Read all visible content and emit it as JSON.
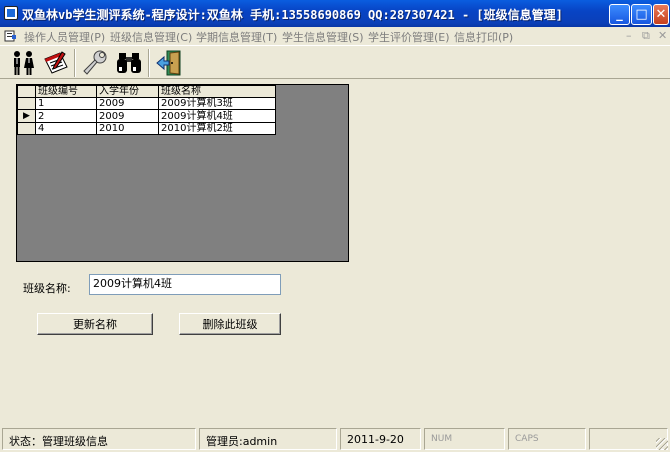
{
  "window": {
    "title": "双鱼林vb学生测评系统-程序设计:双鱼林 手机:13558690869 QQ:287307421 - [班级信息管理]",
    "minimize_glyph": "_",
    "maximize_glyph": "□",
    "close_glyph": "✕"
  },
  "menu": {
    "items": [
      {
        "label": "操作人员管理(P)"
      },
      {
        "label": "班级信息管理(C)"
      },
      {
        "label": "学期信息管理(T)"
      },
      {
        "label": "学生信息管理(S)"
      },
      {
        "label": "学生评价管理(E)"
      },
      {
        "label": "信息打印(P)"
      }
    ],
    "mdi_minimize": "–",
    "mdi_restore": "⧉",
    "mdi_close": "✕"
  },
  "toolbar": {
    "icons": [
      "users-icon",
      "edit-document-icon",
      "wrench-icon",
      "binoculars-icon",
      "exit-door-icon"
    ]
  },
  "grid": {
    "columns": [
      "班级编号",
      "入学年份",
      "班级名称"
    ],
    "rows": [
      {
        "selected": false,
        "cells": [
          "1",
          "2009",
          "2009计算机3班"
        ]
      },
      {
        "selected": true,
        "cells": [
          "2",
          "2009",
          "2009计算机4班"
        ]
      },
      {
        "selected": false,
        "cells": [
          "4",
          "2010",
          "2010计算机2班"
        ]
      }
    ],
    "selected_indicator": "▶"
  },
  "form": {
    "class_name_label": "班级名称:",
    "class_name_value": "2009计算机4班",
    "update_button": "更新名称",
    "delete_button": "删除此班级"
  },
  "statusbar": {
    "status": "状态：管理班级信息",
    "operator": "管理员:admin",
    "date": "2011-9-20",
    "num": "NUM",
    "caps": "CAPS"
  },
  "colors": {
    "titlebar": "#0a5ddf",
    "face": "#ece9d8",
    "grid_background": "#808080"
  }
}
